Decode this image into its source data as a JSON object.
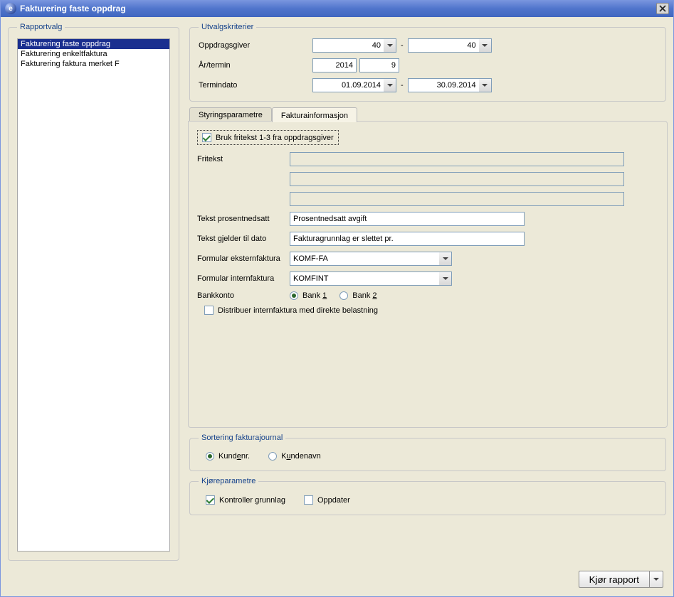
{
  "window": {
    "title": "Fakturering faste oppdrag"
  },
  "sidebar": {
    "title": "Rapportvalg",
    "items": [
      {
        "label": "Fakturering faste oppdrag",
        "selected": true
      },
      {
        "label": "Fakturering enkeltfaktura",
        "selected": false
      },
      {
        "label": "Fakturering faktura merket F",
        "selected": false
      }
    ]
  },
  "criteria": {
    "title": "Utvalgskriterier",
    "oppdragsgiver_label": "Oppdragsgiver",
    "oppdragsgiver_from": "40",
    "oppdragsgiver_to": "40",
    "ar_termin_label": "År/termin",
    "year": "2014",
    "term": "9",
    "termindato_label": "Termindato",
    "date_from": "01.09.2014",
    "date_to": "30.09.2014"
  },
  "tabs": {
    "styring_label": "Styringsparametre",
    "faktura_label": "Fakturainformasjon",
    "active": "faktura"
  },
  "faktura": {
    "use_fritekst_label": "Bruk fritekst 1-3 fra oppdragsgiver",
    "use_fritekst_checked": true,
    "fritekst_label": "Fritekst",
    "fritekst1": "",
    "fritekst2": "",
    "fritekst3": "",
    "tekst_prosent_label": "Tekst prosentnedsatt",
    "tekst_prosent_value": "Prosentnedsatt avgift",
    "tekst_gjelder_label": "Tekst gjelder til dato",
    "tekst_gjelder_value": "Fakturagrunnlag er slettet pr.",
    "formular_ekstern_label": "Formular eksternfaktura",
    "formular_ekstern_value": "KOMF-FA",
    "formular_intern_label": "Formular internfaktura",
    "formular_intern_value": "KOMFINT",
    "bankkonto_label": "Bankkonto",
    "bank1_label_prefix": "Bank ",
    "bank1_label_key": "1",
    "bank2_label_prefix": "Bank ",
    "bank2_label_key": "2",
    "bank_selected": "bank1",
    "distribuer_label": "Distribuer internfaktura med direkte belastning",
    "distribuer_checked": false
  },
  "sortering": {
    "title": "Sortering fakturajournal",
    "kundenr_prefix": "Kund",
    "kundenr_key": "e",
    "kundenr_suffix": "nr.",
    "kundenavn_prefix": "K",
    "kundenavn_key": "u",
    "kundenavn_suffix": "ndenavn",
    "selected": "kundenr"
  },
  "kjore": {
    "title": "Kjøreparametre",
    "kontroller_label": "Kontroller grunnlag",
    "kontroller_checked": true,
    "oppdater_label": "Oppdater",
    "oppdater_checked": false
  },
  "footer": {
    "run_prefix": "K",
    "run_key": "j",
    "run_suffix": "ør rapport"
  }
}
